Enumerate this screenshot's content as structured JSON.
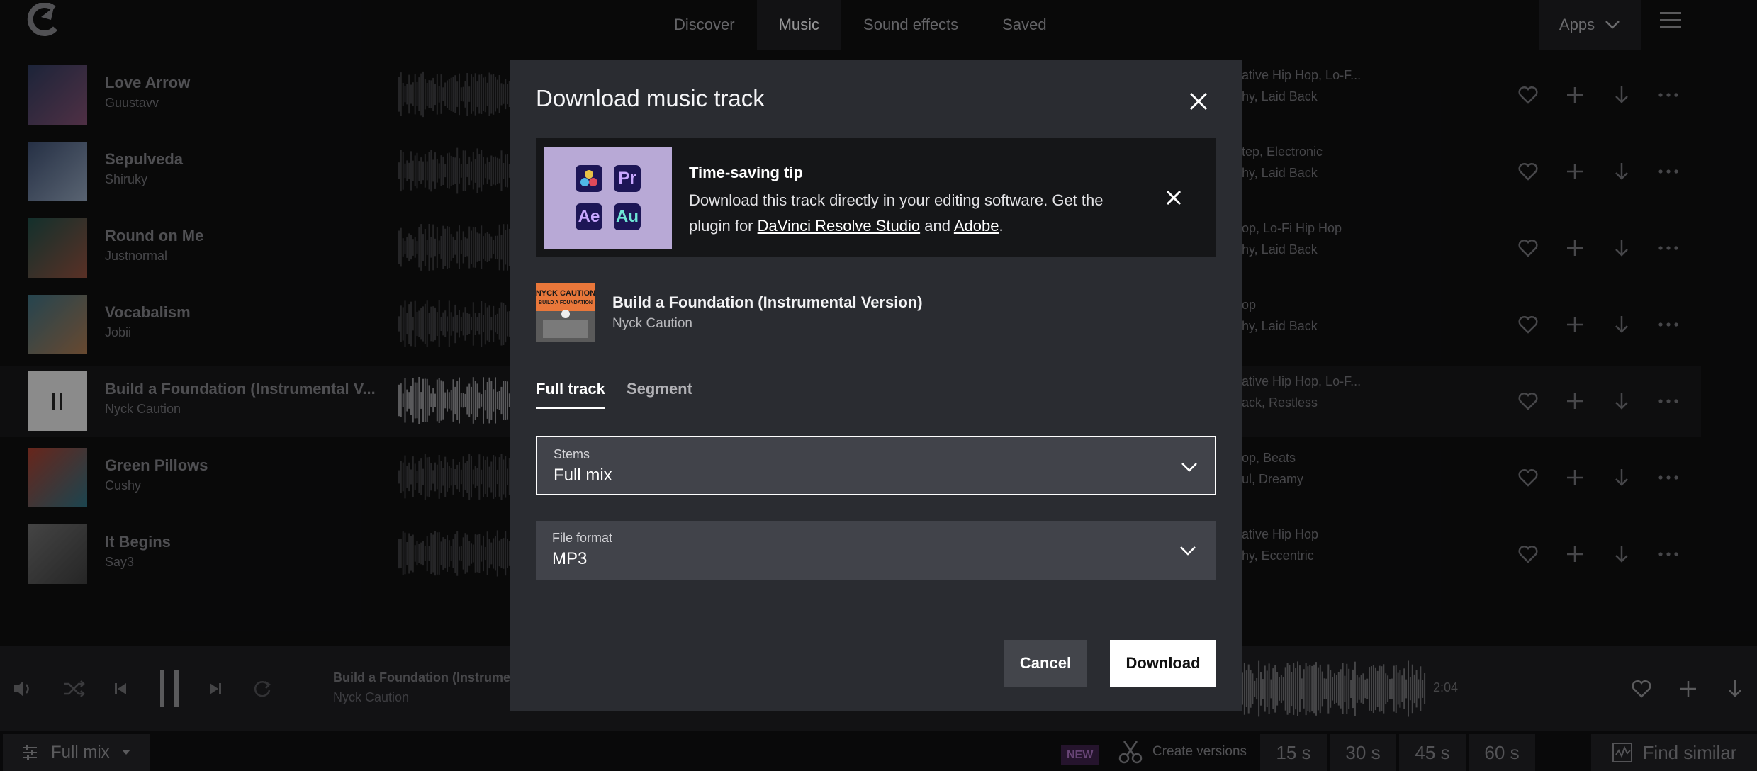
{
  "nav": {
    "tabs": [
      "Discover",
      "Music",
      "Sound effects",
      "Saved"
    ],
    "active_tab": "Music",
    "apps_label": "Apps"
  },
  "tracks": [
    {
      "title": "Love Arrow",
      "artist": "Guustavv",
      "tags1": "ative Hip Hop, Lo-F...",
      "tags2": "hy, Laid Back",
      "cover_colors": [
        "#2c3858",
        "#7a4a6a"
      ]
    },
    {
      "title": "Sepulveda",
      "artist": "Shiruky",
      "tags1": "tep, Electronic",
      "tags2": "hy, Laid Back",
      "cover_colors": [
        "#3a4a6a",
        "#8a9ab0"
      ]
    },
    {
      "title": "Round on Me",
      "artist": "Justnormal",
      "tags1": "op, Lo-Fi Hip Hop",
      "tags2": "hy, Laid Back",
      "cover_colors": [
        "#1e4a44",
        "#8a4a3a"
      ]
    },
    {
      "title": "Vocabalism",
      "artist": "Jobii",
      "tags1": "op",
      "tags2": "hy, Laid Back",
      "cover_colors": [
        "#3a6a7a",
        "#a0704a"
      ]
    },
    {
      "title": "Build a Foundation (Instrumental V...",
      "artist": "Nyck Caution",
      "tags1": "ative Hip Hop, Lo-F...",
      "tags2": "ack, Restless",
      "cover_colors": [
        "#d8d8d8",
        "#d8d8d8"
      ]
    },
    {
      "title": "Green Pillows",
      "artist": "Cushy",
      "tags1": "op, Beats",
      "tags2": "ul, Dreamy",
      "cover_colors": [
        "#a03a2a",
        "#2a6a7a"
      ]
    },
    {
      "title": "It Begins",
      "artist": "Say3",
      "tags1": "ative Hip Hop",
      "tags2": "hy, Eccentric",
      "cover_colors": [
        "#6a6a6a",
        "#3a3a3a"
      ]
    }
  ],
  "player": {
    "title": "Build a Foundation (Instrume",
    "artist": "Nyck Caution",
    "time": "2:04"
  },
  "bottom": {
    "mix_label": "Full mix",
    "new_badge": "NEW",
    "create_versions": "Create versions",
    "durations": [
      "15 s",
      "30 s",
      "45 s",
      "60 s"
    ],
    "find_similar": "Find similar"
  },
  "modal": {
    "title": "Download music track",
    "tip": {
      "title": "Time-saving tip",
      "body_prefix": "Download this track directly in your editing software. Get the plugin for ",
      "link1": "DaVinci Resolve Studio",
      "middle": " and ",
      "link2": "Adobe",
      "suffix": ".",
      "apps": [
        "Pr",
        "Ae",
        "Au"
      ]
    },
    "track": {
      "title": "Build a Foundation (Instrumental Version)",
      "artist": "Nyck Caution",
      "cover_text_1": "NYCK CAUTION",
      "cover_text_2": "BUILD A FOUNDATION"
    },
    "tabs": [
      "Full track",
      "Segment"
    ],
    "active_tab": "Full track",
    "stems": {
      "label": "Stems",
      "value": "Full mix"
    },
    "file_format": {
      "label": "File format",
      "value": "MP3"
    },
    "cancel_label": "Cancel",
    "download_label": "Download"
  },
  "colors": {
    "background": "#0e0e0f",
    "modal": "#2a2c31",
    "tip_background": "#151618",
    "accent_white": "#ffffff"
  }
}
